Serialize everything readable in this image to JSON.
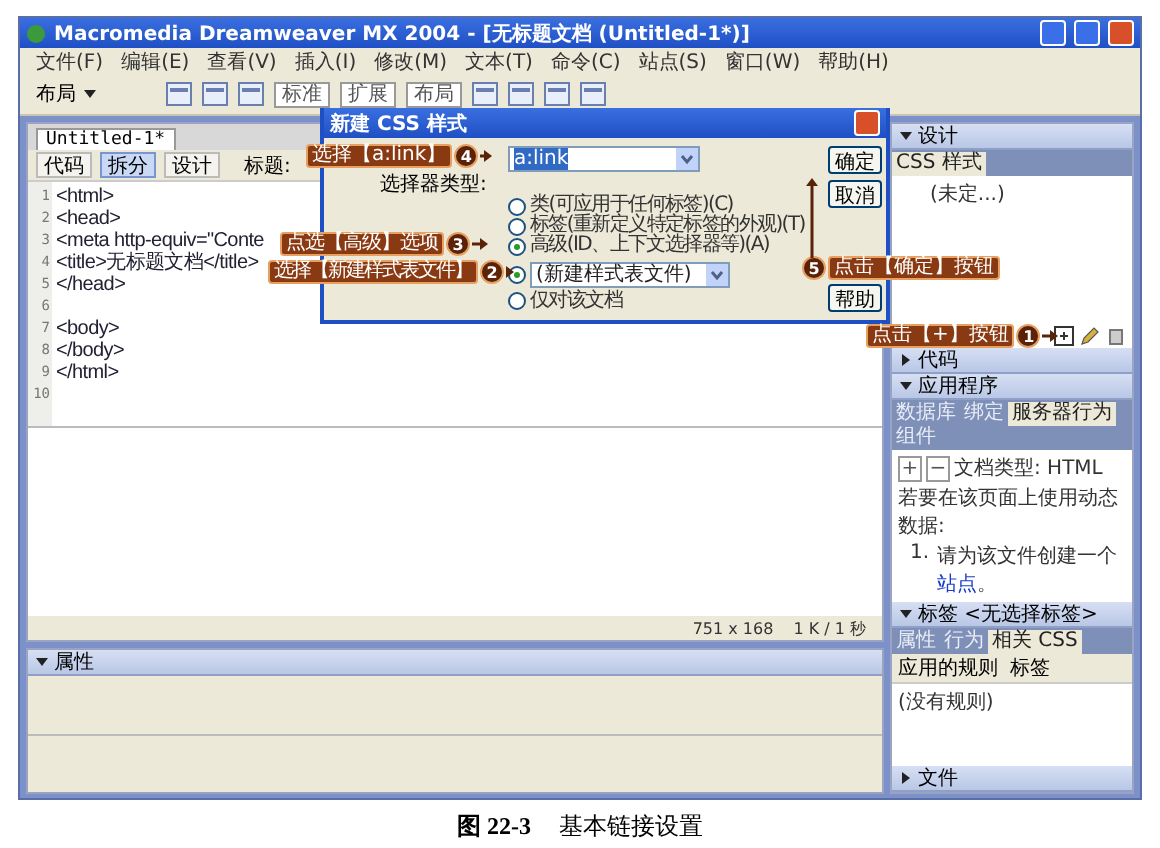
{
  "window": {
    "title": "Macromedia Dreamweaver MX 2004 - [无标题文档 (Untitled-1*)]"
  },
  "menu": [
    "文件(F)",
    "编辑(E)",
    "查看(V)",
    "插入(I)",
    "修改(M)",
    "文本(T)",
    "命令(C)",
    "站点(S)",
    "窗口(W)",
    "帮助(H)"
  ],
  "toolbar": {
    "category": "布局",
    "view_buttons": [
      "标准",
      "扩展",
      "布局"
    ]
  },
  "document": {
    "tab": "Untitled-1*",
    "view_tabs": [
      {
        "label": "代码",
        "selected": false
      },
      {
        "label": "拆分",
        "selected": true
      },
      {
        "label": "设计",
        "selected": false
      }
    ],
    "title_label": "标题:",
    "code_lines": [
      {
        "number": "1",
        "text": "<html>"
      },
      {
        "number": "2",
        "text": "<head>"
      },
      {
        "number": "3",
        "text": "<meta http-equiv=\"Conte"
      },
      {
        "number": "4",
        "text": "<title>无标题文档</title>"
      },
      {
        "number": "5",
        "text": "</head>"
      },
      {
        "number": "6"
      },
      {
        "number": "7",
        "text": "<body>"
      },
      {
        "number": "8",
        "text": "</body>"
      },
      {
        "number": "9",
        "text": "</html>"
      },
      {
        "number": "10"
      }
    ],
    "size": "751 x 168",
    "weight": "1 K / 1 秒"
  },
  "properties_panel": {
    "title": "属性",
    "expanded": true
  },
  "side_panels": [
    {
      "kind": "css",
      "title": "设计",
      "expanded": true,
      "tabs": [
        {
          "label": "CSS 样式",
          "selected": true
        }
      ],
      "content": "(未定...)"
    },
    {
      "kind": "plain",
      "title": "代码",
      "expanded": false
    },
    {
      "kind": "app",
      "title": "应用程序",
      "expanded": true,
      "tabs": [
        {
          "label": "数据库",
          "selected": false
        },
        {
          "label": "绑定",
          "selected": false
        },
        {
          "label": "服务器行为",
          "selected": true
        },
        {
          "label": "组件",
          "selected": false
        }
      ],
      "buttons": [
        "+",
        "−"
      ],
      "doc_type": "文档类型: HTML",
      "message": "若要在该页面上使用动态数据:",
      "step_number": "1.",
      "step_text": "请为该文件创建一个",
      "step_link": "站点",
      "step_end": "。"
    },
    {
      "kind": "tag",
      "title": "标签 <无选择标签>",
      "expanded": true,
      "tabs": [
        {
          "label": "属性",
          "selected": false
        },
        {
          "label": "行为",
          "selected": false
        },
        {
          "label": "相关 CSS",
          "selected": true
        }
      ],
      "columns": [
        "应用的规则",
        "标签"
      ],
      "row": "(没有规则)"
    },
    {
      "kind": "plain",
      "title": "文件",
      "expanded": false
    }
  ],
  "dialog": {
    "title": "新建 CSS 样式",
    "name_value": "a:link",
    "selector_label": "选择器类型:",
    "selector_options": [
      {
        "label": "类(可应用于任何标签)(C)",
        "selected": false
      },
      {
        "label": "标签(重新定义特定标签的外观)(T)",
        "selected": false
      },
      {
        "label": "高级(ID、上下文选择器等)(A)",
        "selected": true
      }
    ],
    "define_options": [
      {
        "label": "(新建样式表文件)",
        "kind": "select",
        "selected": true
      },
      {
        "label": "仅对该文档",
        "kind": "text",
        "selected": false
      }
    ],
    "buttons": [
      "确定",
      "取消",
      "帮助"
    ]
  },
  "callouts": [
    {
      "number": "4",
      "text": "选择【a:link】"
    },
    {
      "number": "3",
      "text": "点选【高级】选项"
    },
    {
      "number": "2",
      "text": "选择【新建样式表文件】"
    },
    {
      "number": "5",
      "text": "点击【确定】按钮"
    },
    {
      "number": "1",
      "text": "点击【+】按钮"
    }
  ],
  "caption": {
    "figure": "图 22-3",
    "text": "基本链接设置"
  }
}
